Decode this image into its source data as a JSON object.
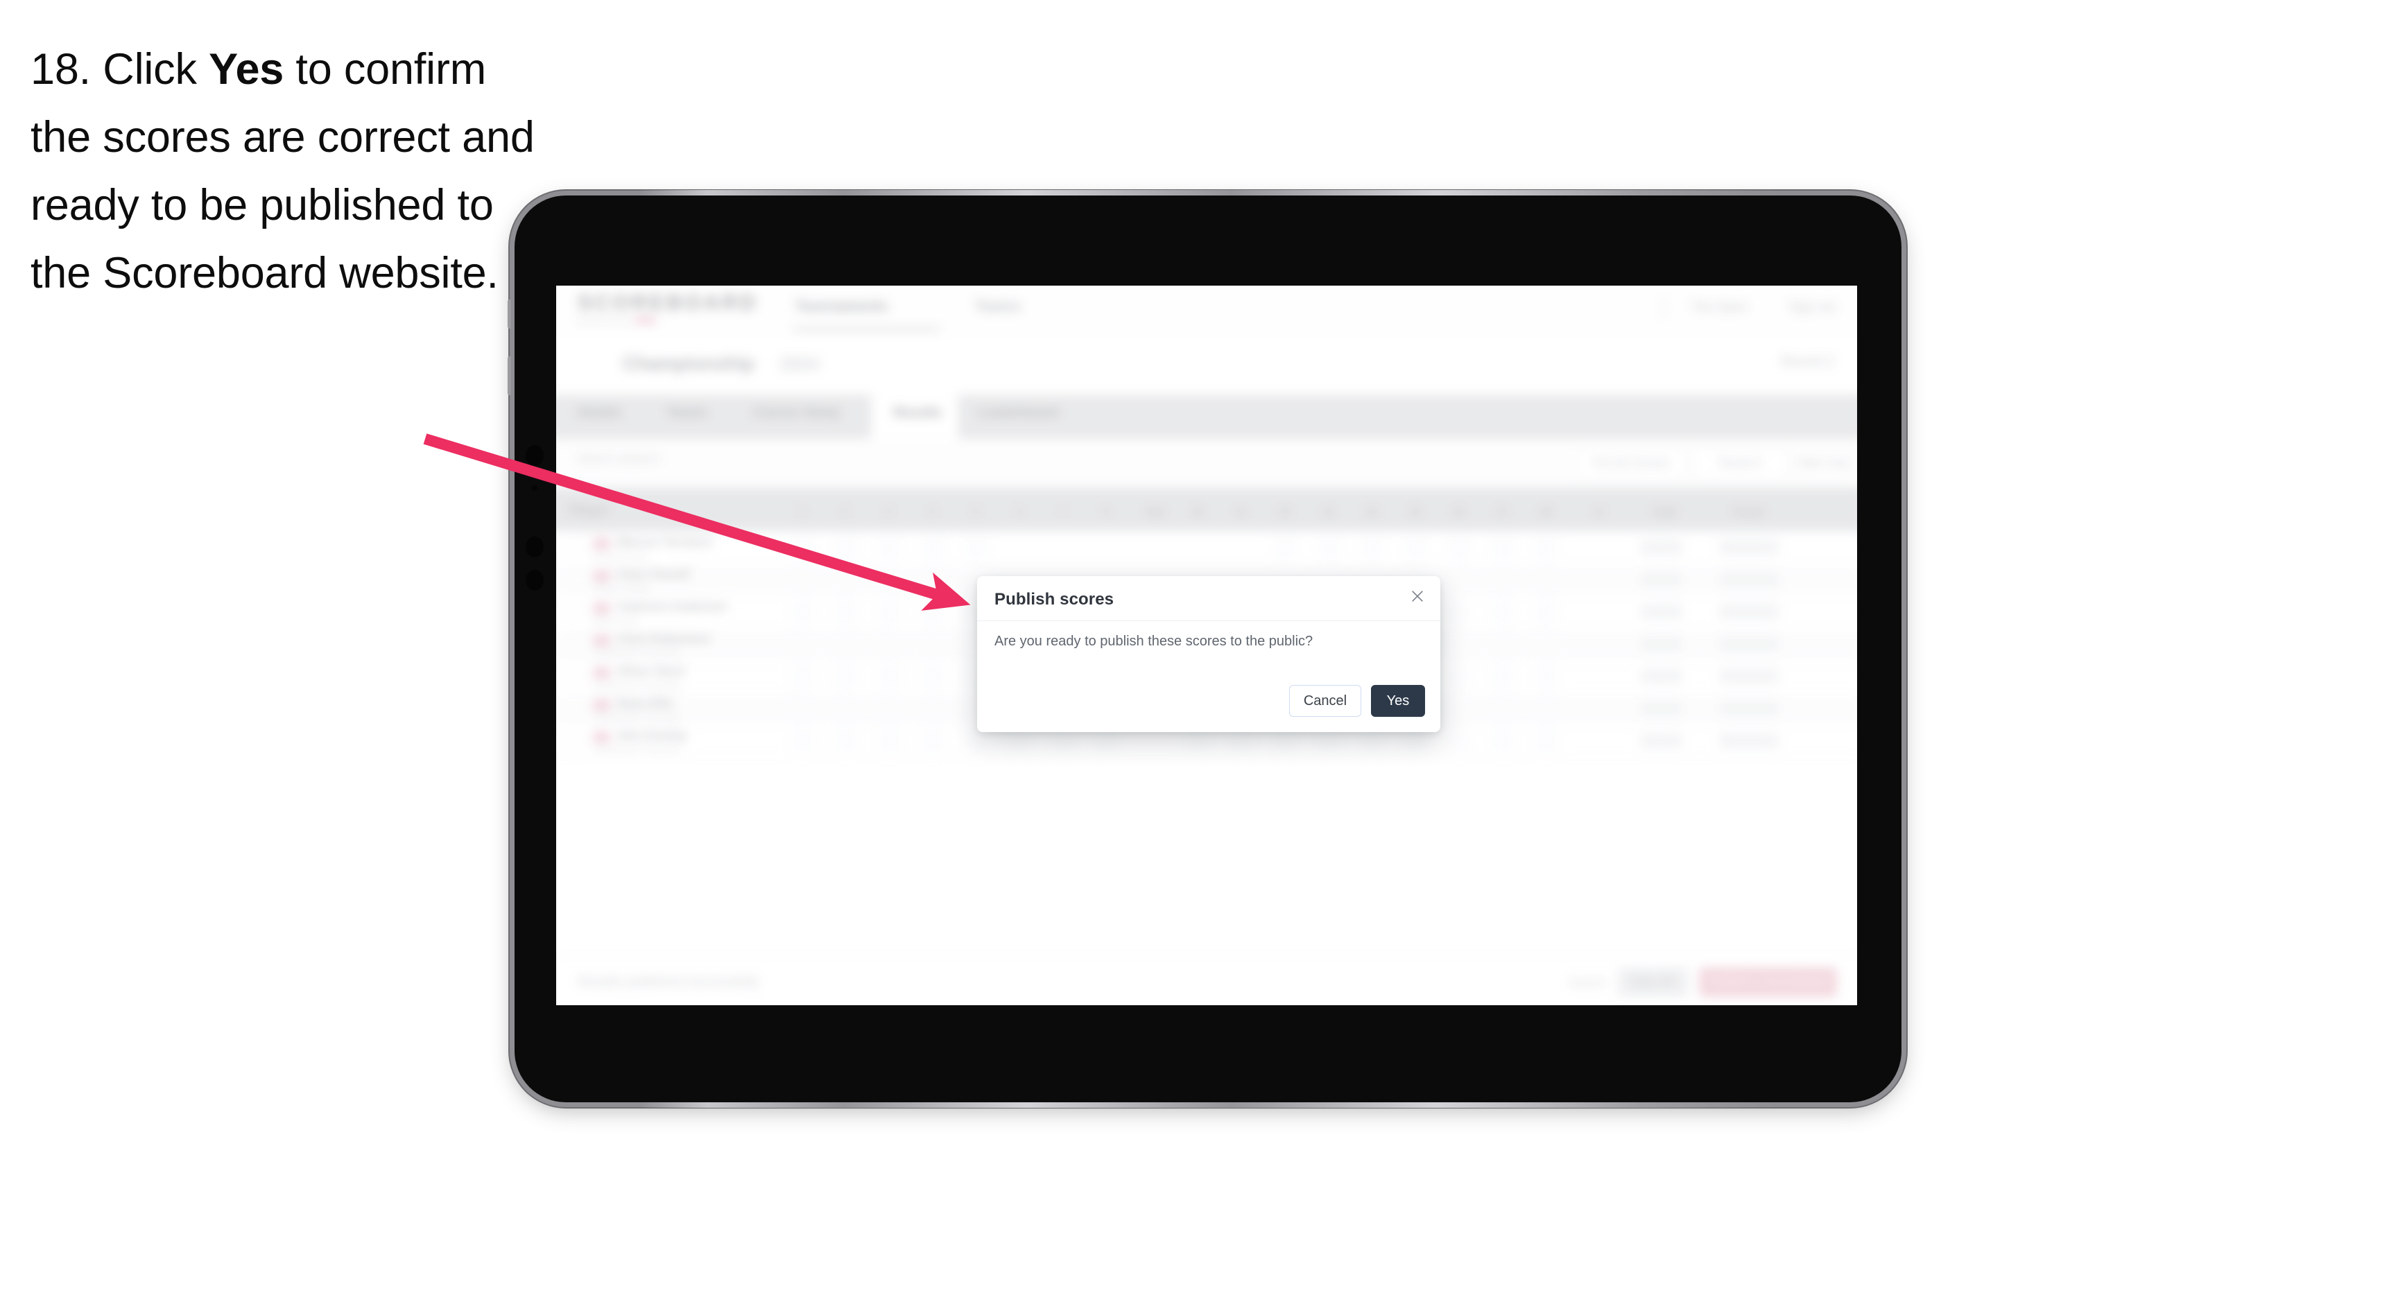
{
  "instruction": {
    "number": "18.",
    "text_before": "Click ",
    "emphasis": "Yes",
    "text_after": " to confirm the scores are correct and ready to be published to the Scoreboard website."
  },
  "annotation": {
    "arrow_color": "#EC2E61",
    "arrow_from": "613,633",
    "arrow_to": "1395,875"
  },
  "device": {
    "kind": "tablet",
    "body_color": "#0B0B0C",
    "bezel_color": "#8F8F93"
  },
  "dialog": {
    "title": "Publish scores",
    "body": "Are you ready to publish these scores to the public?",
    "close_glyph": "✕",
    "cancel_label": "Cancel",
    "confirm_label": "Yes",
    "confirm_color": "#2D3949"
  },
  "app": {
    "brand": "SCOREBOARD",
    "brand_sub_left": "powered by",
    "brand_sub_accent": "PAR",
    "nav_links": [
      "Tournaments",
      "Teams"
    ],
    "nav_account": "The Open",
    "nav_signout": "Sign out",
    "event_title": "Championship",
    "event_year": "2024",
    "event_right": "Round 2",
    "tabs": [
      "Details",
      "Teams",
      "Course Setup",
      "Results",
      "Leaderboard"
    ],
    "active_tab": "Results",
    "search_placeholder": "Search players",
    "filters": [
      "Pro-Am Scores",
      "Round 2",
      "Table Only"
    ],
    "columns": [
      "Player",
      "1",
      "2",
      "3",
      "4",
      "5",
      "6",
      "7",
      "8",
      "Out",
      "10",
      "11",
      "12",
      "13",
      "14",
      "15",
      "16",
      "17",
      "18",
      "In",
      "Total",
      "Points"
    ],
    "rows": [
      {
        "name": "Marcus Torrance",
        "club": "Royal County"
      },
      {
        "name": "Peter Parnell",
        "club": "Royal College"
      },
      {
        "name": "Cameron Anderson",
        "club": "Baker Park"
      },
      {
        "name": "Chris Robertson",
        "club": "Sunderland Township"
      },
      {
        "name": "Oliver Short",
        "club": "Sunderland Township"
      },
      {
        "name": "Ryan Ellis",
        "club": "Sunderland Township"
      },
      {
        "name": "Alex Dunlop",
        "club": "Sunderland Township"
      }
    ],
    "footer_note": "Results published successfully",
    "footer_link": "Cancel",
    "footer_secondary": "Save All",
    "footer_danger": "Publish to Scoreboard"
  }
}
